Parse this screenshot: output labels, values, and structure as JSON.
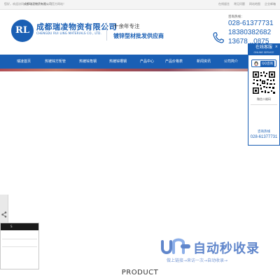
{
  "topbar": {
    "welcome_prefix": "您好，欢迎访问",
    "welcome_company": "成都瑞凌物资有限公司",
    "welcome_suffix": "官方网站！",
    "links": [
      "在线留言",
      "常见问题",
      "网站地图",
      "企业邮箱"
    ]
  },
  "header": {
    "logo_text": "RL",
    "company_cn": "成都瑞凌物资有限公司",
    "company_en": "CHENGDU RUI LING MATERIALS CO., LTD.",
    "slogan_line1": "十余年专注",
    "slogan_line2": "镀锌型材批发供应商",
    "hotline_label": "咨询热线：",
    "hotlines": [
      "028-61377731",
      "18380382682",
      "13678 ..0875"
    ]
  },
  "nav": {
    "items": [
      "瑞凌首页",
      "热镀锌方矩管",
      "热镀锌角钢",
      "热镀锌槽钢",
      "产品中心",
      "产品价格表",
      "新闻资讯",
      "公司简介"
    ]
  },
  "float_panel": {
    "title": "在线客服",
    "subtitle": "ONLINE SERVICE",
    "close": "×",
    "qq_label": "QQ咨询",
    "qr_label": "微信二维码",
    "hotline_label": "咨询热线",
    "hotline": "028-61377731"
  },
  "share": {
    "box_title": "S"
  },
  "watermark": {
    "title": "自动秒收录",
    "subtitle": "做上链接→来访一次→自动收录→"
  },
  "section": {
    "product_title": "PRODUCT"
  },
  "colors": {
    "brand_blue": "#1a5fb4",
    "topbar_bg": "#f4f4f4"
  }
}
